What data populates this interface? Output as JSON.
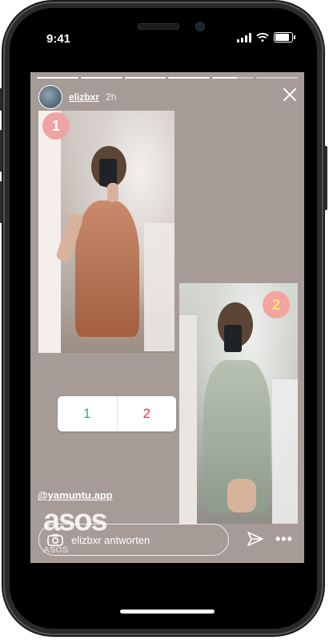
{
  "status_bar": {
    "time": "9:41"
  },
  "story": {
    "progress_segments": [
      1,
      1,
      1,
      1,
      0.6,
      0
    ],
    "username": "elizbxr",
    "time_ago": "2h",
    "badges": [
      "1",
      "2"
    ],
    "poll": {
      "option_1": "1",
      "option_2": "2",
      "option_1_color": "#17b89a",
      "option_2_color": "#e8384a"
    },
    "mention": "@yamuntu.app",
    "brand_logo": "asos",
    "brand_caption": "ASOS",
    "reply_placeholder": "elizbxr antworten",
    "more_label": "•••"
  },
  "colors": {
    "story_background": "#a69b97",
    "badge_pink": "#f0a3a3"
  }
}
